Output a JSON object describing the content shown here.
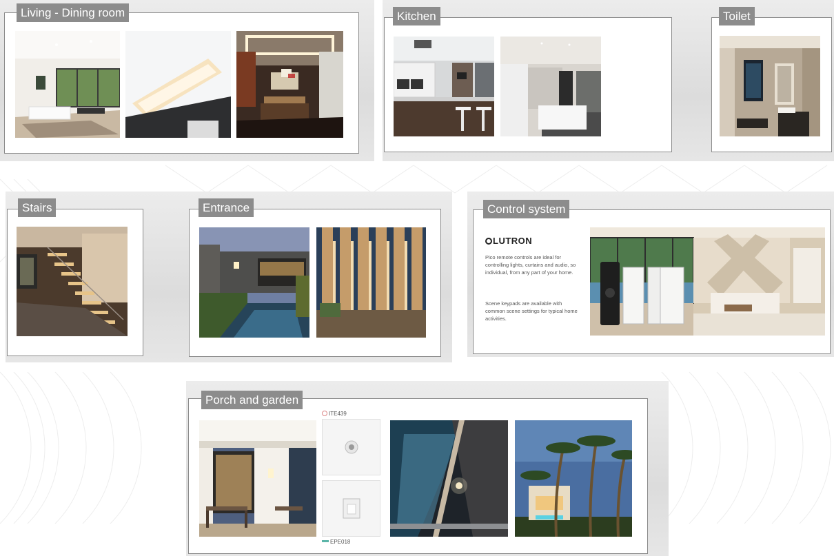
{
  "sections": {
    "living": {
      "title": "Living - Dining room"
    },
    "kitchen": {
      "title": "Kitchen"
    },
    "toilet": {
      "title": "Toilet"
    },
    "stairs": {
      "title": "Stairs"
    },
    "entrance": {
      "title": "Entrance"
    },
    "control": {
      "title": "Control system",
      "brand": "LUTRON",
      "paragraph1": "Pico remote controls are ideal for controlling lights, curtains and audio, so individual, from any part of your home.",
      "paragraph2": "Scene keypads are available with common scene settings for typical home activities."
    },
    "porch": {
      "title": "Porch and garden",
      "product1": "ITE439",
      "product2": "EPE018"
    }
  },
  "colors": {
    "title_bg": "#8c8c8c",
    "title_text": "#ffffff",
    "card_border": "#8a8a8a"
  }
}
